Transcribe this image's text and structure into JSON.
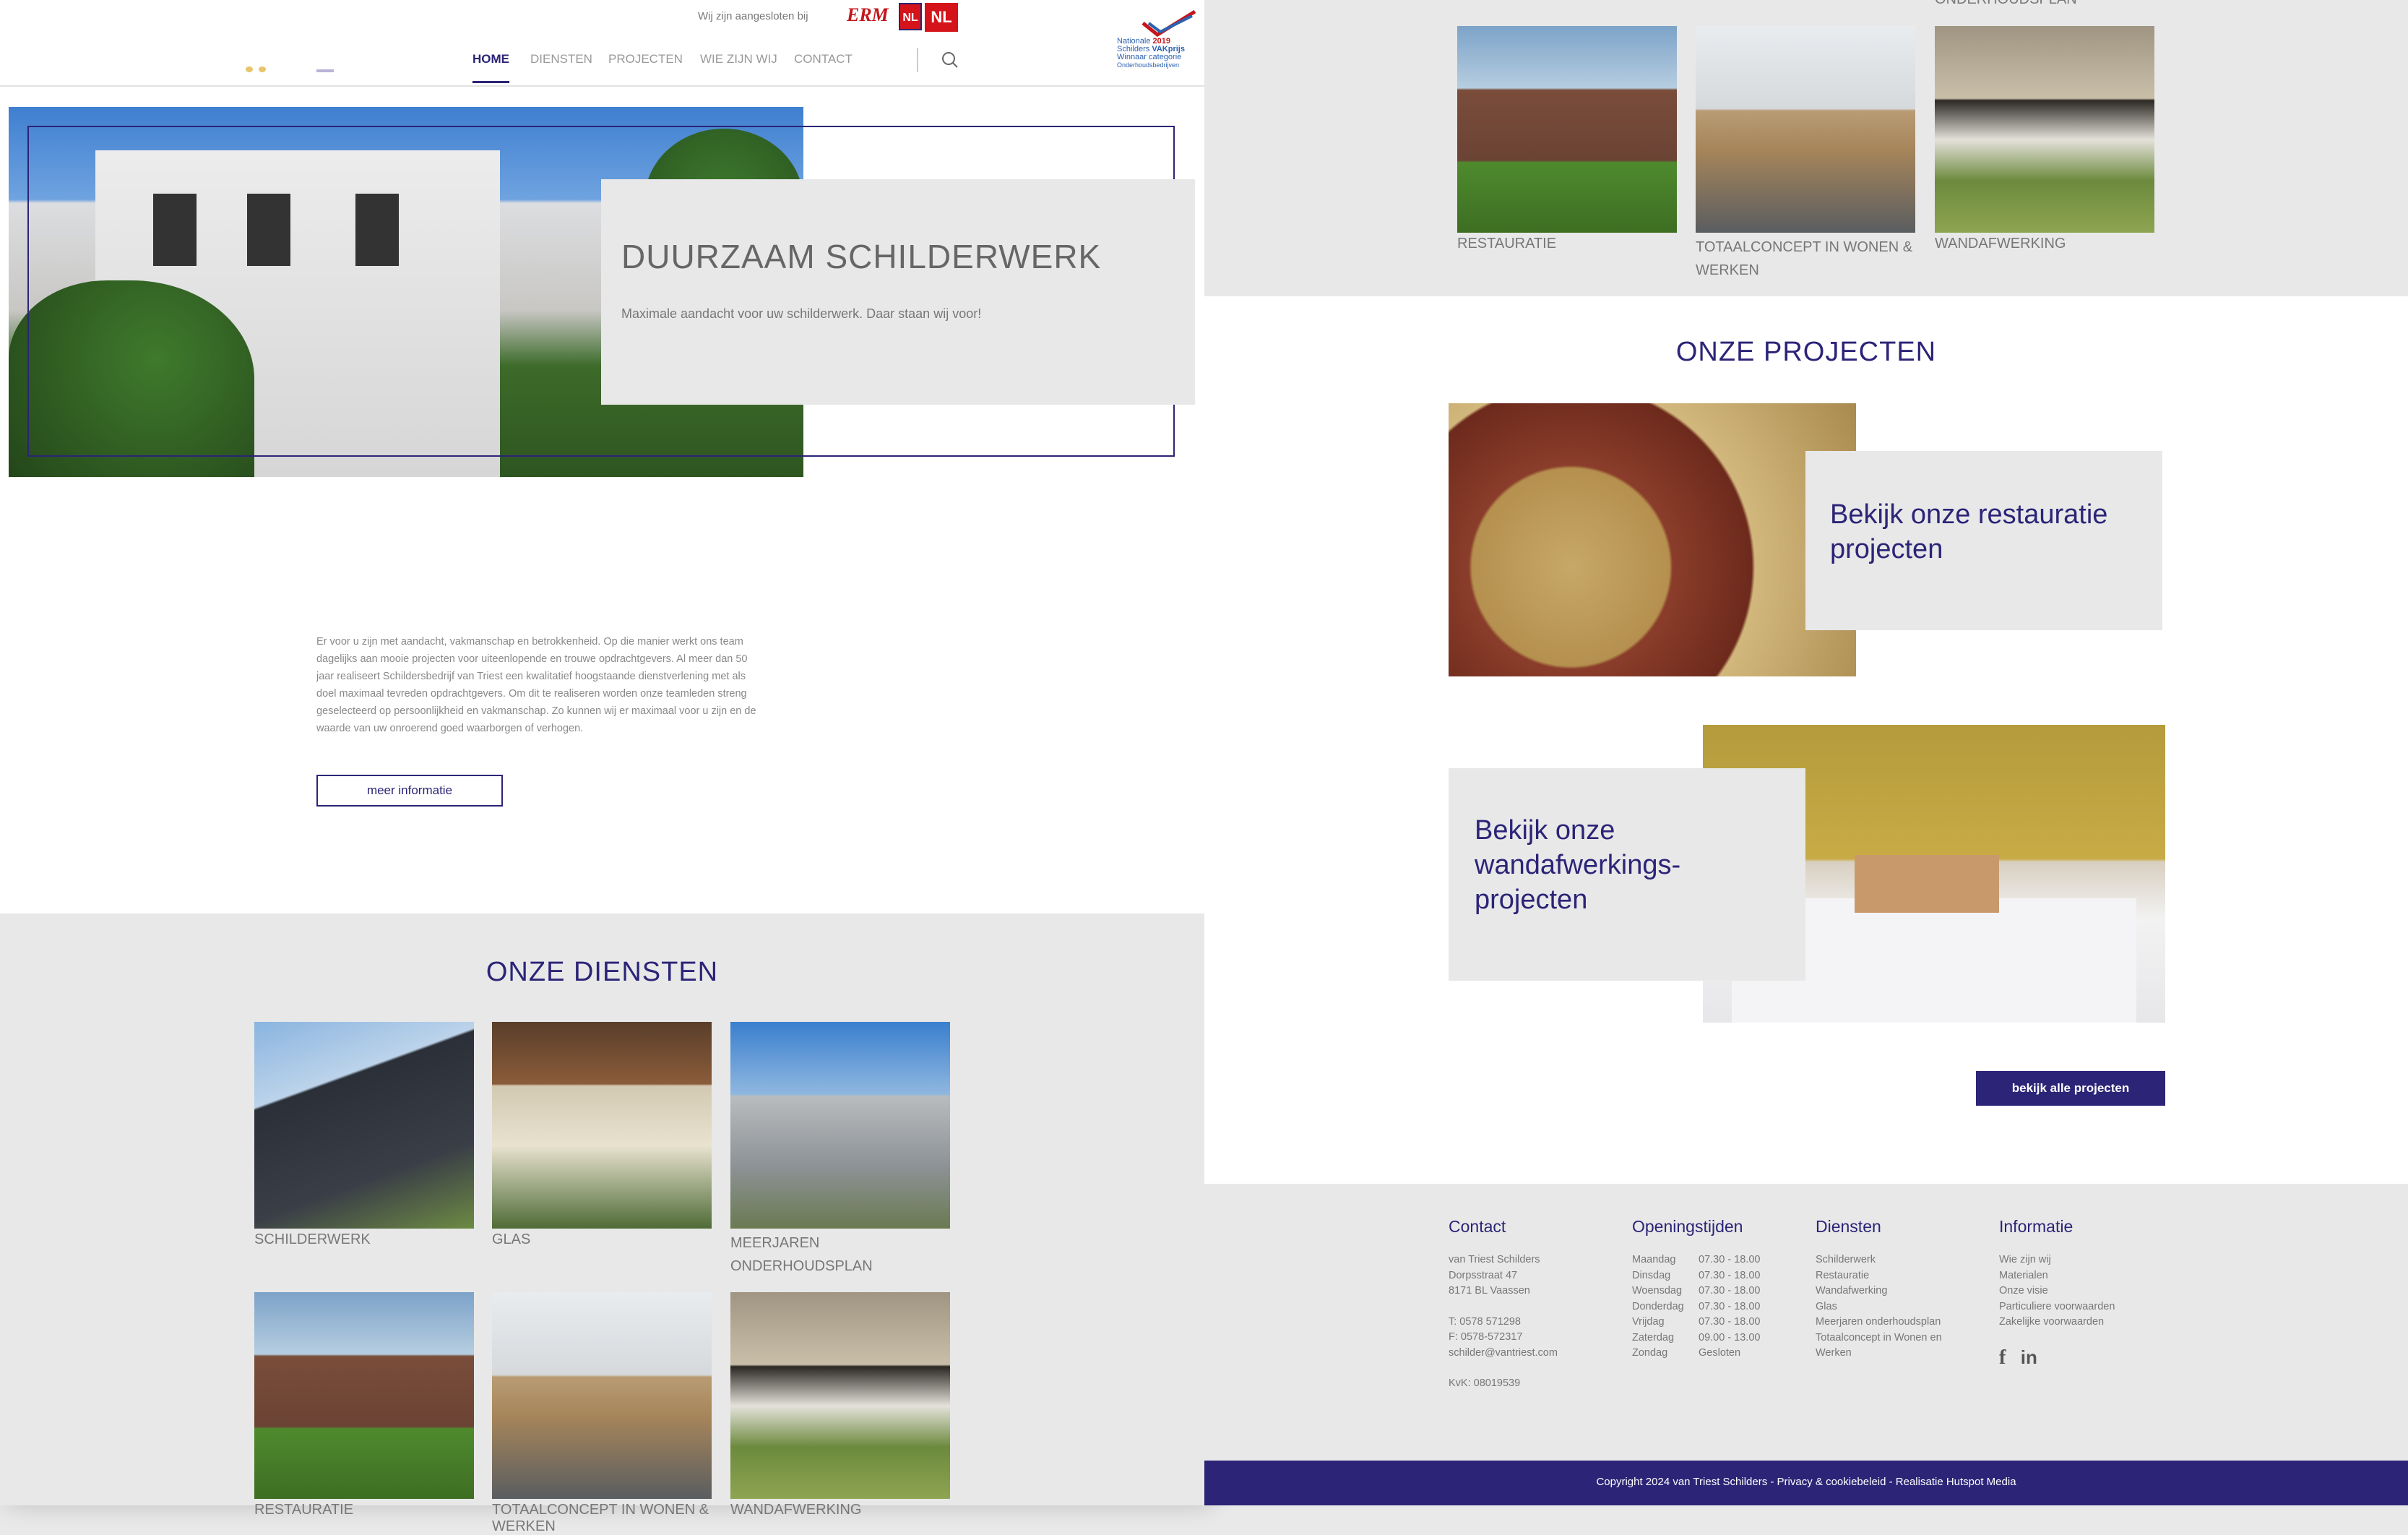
{
  "header": {
    "affiliated_text": "Wij zijn aangesloten bij",
    "badges": [
      "ERM",
      "NL",
      "NL"
    ],
    "prize_lines": [
      "Nationale",
      "Schilders",
      "VAKprijs",
      "2019",
      "Winnaar categorie",
      "Onderhoudsbedrijven"
    ],
    "nav": [
      {
        "label": "HOME",
        "active": true
      },
      {
        "label": "DIENSTEN",
        "active": false
      },
      {
        "label": "PROJECTEN",
        "active": false
      },
      {
        "label": "WIE ZIJN WIJ",
        "active": false
      },
      {
        "label": "CONTACT",
        "active": false
      }
    ],
    "search_icon": "search-icon"
  },
  "hero": {
    "title": "DUURZAAM SCHILDERWERK",
    "subtitle": "Maximale aandacht voor uw schilderwerk. Daar staan wij voor!"
  },
  "intro": {
    "text": "Er voor u zijn met aandacht, vakmanschap en betrokkenheid. Op die manier werkt ons team dagelijks aan mooie projecten voor uiteenlopende en trouwe opdrachtgevers. Al meer dan 50 jaar realiseert Schildersbedrijf van Triest een kwalitatief hoogstaande dienstverlening met als doel maximaal tevreden opdrachtgevers. Om dit te realiseren worden onze teamleden streng geselecteerd op persoonlijkheid en vakmanschap. Zo kunnen wij er maximaal voor u zijn en de waarde van uw onroerend goed waarborgen of verhogen.",
    "button": "meer informatie"
  },
  "services": {
    "title": "ONZE DIENSTEN",
    "items": [
      {
        "label": "SCHILDERWERK"
      },
      {
        "label": "GLAS"
      },
      {
        "label": "MEERJAREN ONDERHOUDSPLAN"
      },
      {
        "label": "RESTAURATIE"
      },
      {
        "label": "TOTAALCONCEPT IN WONEN & WERKEN"
      },
      {
        "label": "WANDAFWERKING"
      }
    ],
    "top_right_cut_label": "ONDERHOUDSPLAN"
  },
  "projects": {
    "title": "ONZE PROJECTEN",
    "card1": "Bekijk onze restauratie projecten",
    "card2": "Bekijk onze wandafwerkings-projecten",
    "button": "bekijk alle projecten"
  },
  "footer": {
    "contact": {
      "title": "Contact",
      "lines": [
        "van Triest Schilders",
        "Dorpsstraat 47",
        "8171 BL Vaassen",
        "",
        "T: 0578 571298",
        "F: 0578-572317",
        "schilder@vantriest.com",
        "",
        "KvK: 08019539"
      ]
    },
    "hours": {
      "title": "Openingstijden",
      "rows": [
        {
          "day": "Maandag",
          "time": "07.30 - 18.00"
        },
        {
          "day": "Dinsdag",
          "time": "07.30 - 18.00"
        },
        {
          "day": "Woensdag",
          "time": "07.30 - 18.00"
        },
        {
          "day": "Donderdag",
          "time": "07.30 - 18.00"
        },
        {
          "day": "Vrijdag",
          "time": "07.30 - 18.00"
        },
        {
          "day": "Zaterdag",
          "time": "09.00 - 13.00"
        },
        {
          "day": "Zondag",
          "time": "Gesloten"
        }
      ]
    },
    "services": {
      "title": "Diensten",
      "links": [
        "Schilderwerk",
        "Restauratie",
        "Wandafwerking",
        "Glas",
        "Meerjaren onderhoudsplan",
        "Totaalconcept in Wonen en Werken"
      ]
    },
    "info": {
      "title": "Informatie",
      "links": [
        "Wie zijn wij",
        "Materialen",
        "Onze visie",
        "Particuliere voorwaarden",
        "Zakelijke voorwaarden"
      ]
    },
    "social": [
      "facebook-icon",
      "linkedin-icon"
    ],
    "copyright": "Copyright 2024 van Triest Schilders - Privacy & cookiebeleid - Realisatie Hutspot Media"
  },
  "colors": {
    "brand": "#2b2477",
    "panel": "#e6e6e6"
  }
}
